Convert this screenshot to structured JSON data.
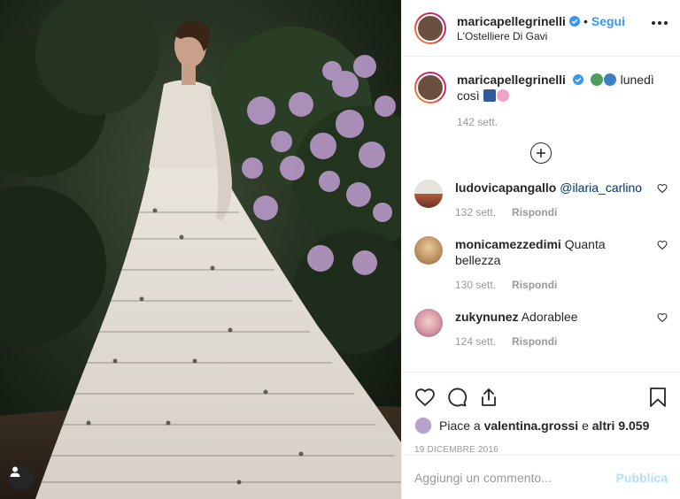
{
  "post": {
    "username": "maricapellegrinelli",
    "follow_label": "Segui",
    "separator": "•",
    "location": "L'Ostelliere Di Gavi"
  },
  "caption": {
    "username": "maricapellegrinelli",
    "text_after_emoji": "lunedì",
    "text_line2": "così",
    "time": "142 sett."
  },
  "comments": [
    {
      "username": "ludovicapangallo",
      "text": "@ilaria_carlino",
      "time": "132 sett.",
      "reply": "Rispondi"
    },
    {
      "username": "monicamezzedimi",
      "text": "Quanta bellezza",
      "time": "130 sett.",
      "reply": "Rispondi"
    },
    {
      "username": "zukynunez",
      "text": "Adorablee",
      "time": "124 sett.",
      "reply": "Rispondi"
    }
  ],
  "likes": {
    "prefix": "Piace a",
    "user": "valentina.grossi",
    "joiner": "e",
    "others": "altri 9.059"
  },
  "date": "19 DICEMBRE 2016",
  "add_comment": {
    "placeholder": "Aggiungi un commento...",
    "publish_label": "Pubblica"
  },
  "colors": {
    "link_blue": "#3897f0",
    "publish_disabled": "#b2dffc",
    "muted_text": "#999999",
    "text": "#262626"
  },
  "icons": [
    "more-options-icon",
    "verified-badge-icon",
    "plus-circle-icon",
    "heart-icon",
    "comment-icon",
    "share-icon",
    "bookmark-icon",
    "user-tag-icon"
  ]
}
